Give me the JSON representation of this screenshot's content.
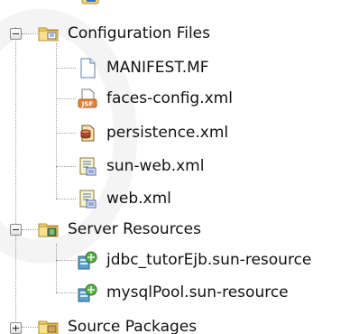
{
  "tree": {
    "groups": [
      {
        "label": "Configuration Files",
        "icon": "config-folder-icon",
        "expanded": true,
        "children": [
          {
            "label": "MANIFEST.MF",
            "icon": "file-icon"
          },
          {
            "label": "faces-config.xml",
            "icon": "jsf-file-icon"
          },
          {
            "label": "persistence.xml",
            "icon": "persistence-icon"
          },
          {
            "label": "sun-web.xml",
            "icon": "xml-descriptor-icon"
          },
          {
            "label": "web.xml",
            "icon": "xml-descriptor-icon"
          }
        ]
      },
      {
        "label": "Server Resources",
        "icon": "server-folder-icon",
        "expanded": true,
        "children": [
          {
            "label": "jdbc_tutorEjb.sun-resource",
            "icon": "resource-icon"
          },
          {
            "label": "mysqlPool.sun-resource",
            "icon": "resource-icon"
          }
        ]
      },
      {
        "label": "Source Packages",
        "icon": "source-folder-icon",
        "expanded": false,
        "children": []
      }
    ]
  }
}
